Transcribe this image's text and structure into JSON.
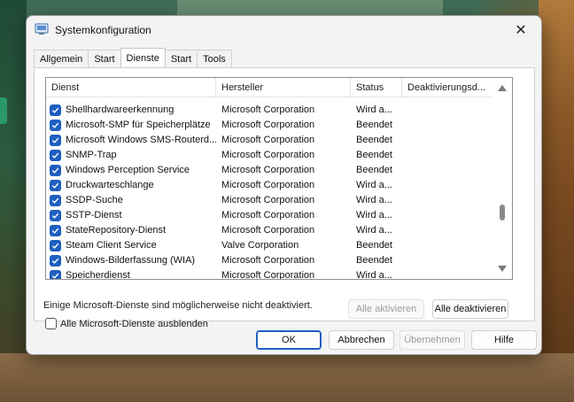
{
  "window": {
    "title": "Systemkonfiguration",
    "close_glyph": "✕",
    "icon": "msconfig-icon"
  },
  "tabs": [
    "Allgemein",
    "Start",
    "Dienste",
    "Start",
    "Tools"
  ],
  "active_tab": "Dienste",
  "table": {
    "columns": [
      "Dienst",
      "Hersteller",
      "Status",
      "Deaktivierungsd..."
    ],
    "rows": [
      {
        "name": "Shellhardwareerkennung",
        "vendor": "Microsoft Corporation",
        "status": "Wird a...",
        "disabled_date": "",
        "checked": true
      },
      {
        "name": "Microsoft-SMP für Speicherplätze",
        "vendor": "Microsoft Corporation",
        "status": "Beendet",
        "disabled_date": "",
        "checked": true
      },
      {
        "name": "Microsoft Windows SMS-Routerd...",
        "vendor": "Microsoft Corporation",
        "status": "Beendet",
        "disabled_date": "",
        "checked": true
      },
      {
        "name": "SNMP-Trap",
        "vendor": "Microsoft Corporation",
        "status": "Beendet",
        "disabled_date": "",
        "checked": true
      },
      {
        "name": "Windows Perception Service",
        "vendor": "Microsoft Corporation",
        "status": "Beendet",
        "disabled_date": "",
        "checked": true
      },
      {
        "name": "Druckwarteschlange",
        "vendor": "Microsoft Corporation",
        "status": "Wird a...",
        "disabled_date": "",
        "checked": true
      },
      {
        "name": "SSDP-Suche",
        "vendor": "Microsoft Corporation",
        "status": "Wird a...",
        "disabled_date": "",
        "checked": true
      },
      {
        "name": "SSTP-Dienst",
        "vendor": "Microsoft Corporation",
        "status": "Wird a...",
        "disabled_date": "",
        "checked": true
      },
      {
        "name": "StateRepository-Dienst",
        "vendor": "Microsoft Corporation",
        "status": "Wird a...",
        "disabled_date": "",
        "checked": true
      },
      {
        "name": "Steam Client Service",
        "vendor": "Valve Corporation",
        "status": "Beendet",
        "disabled_date": "",
        "checked": true
      },
      {
        "name": "Windows-Bilderfassung (WIA)",
        "vendor": "Microsoft Corporation",
        "status": "Beendet",
        "disabled_date": "",
        "checked": true
      },
      {
        "name": "Speicherdienst",
        "vendor": "Microsoft Corporation",
        "status": "Wird a...",
        "disabled_date": "",
        "checked": true
      }
    ]
  },
  "info_text": "Einige Microsoft-Dienste sind möglicherweise nicht deaktiviert.",
  "buttons": {
    "enable_all": "Alle aktivieren",
    "disable_all": "Alle deaktivieren",
    "ok": "OK",
    "cancel": "Abbrechen",
    "apply": "Übernehmen",
    "help": "Hilfe"
  },
  "hide_ms_services": {
    "label": "Alle Microsoft-Dienste ausblenden",
    "checked": false
  },
  "colors": {
    "accent": "#1f5fbf",
    "dialog_bg": "#f3f3f3"
  }
}
